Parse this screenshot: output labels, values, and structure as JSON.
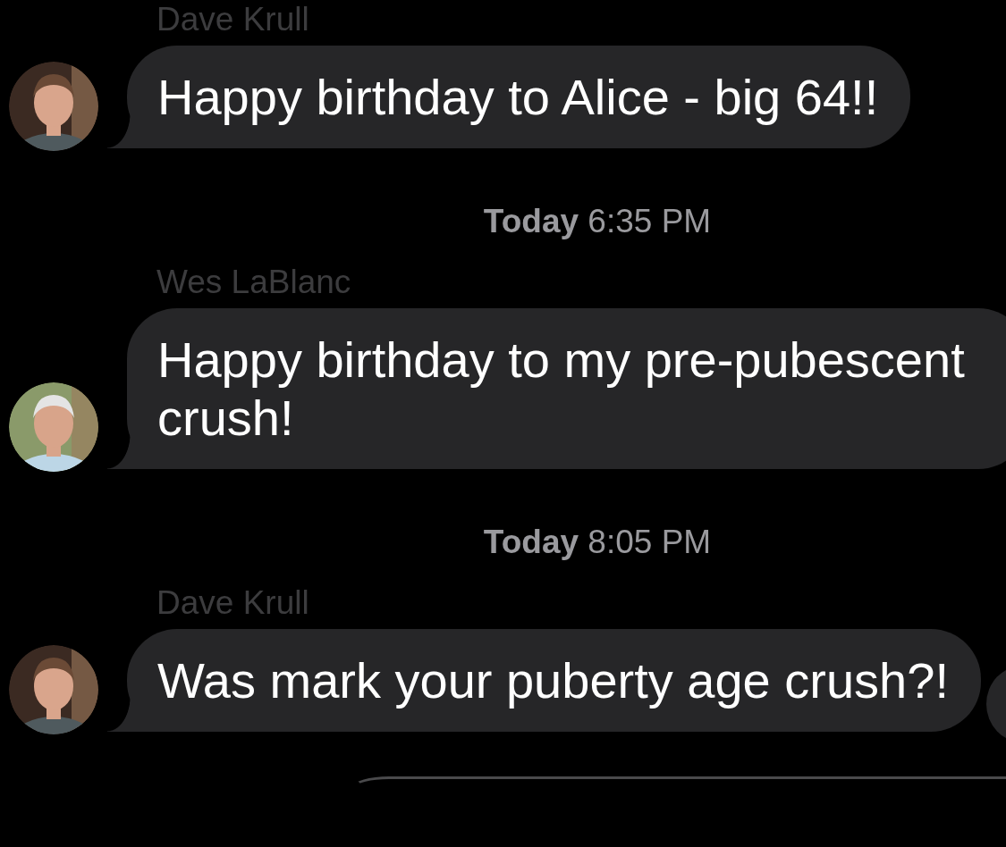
{
  "feed": [
    {
      "kind": "sender",
      "text": "Dave Krull"
    },
    {
      "kind": "message",
      "text": "Happy birthday to Alice - big 64!!"
    },
    {
      "kind": "timestamp",
      "text": "**Today** 6:35 PM"
    },
    {
      "kind": "sender",
      "text": "Wes LaBlanc"
    },
    {
      "kind": "message",
      "text": "Happy birthday to my pre-pubescent crush!"
    },
    {
      "kind": "timestamp",
      "text": "**Today** 8:05 PM"
    },
    {
      "kind": "sender",
      "text": "Dave Krull"
    },
    {
      "kind": "message",
      "text": "Was mark your puberty age crush?!"
    }
  ]
}
